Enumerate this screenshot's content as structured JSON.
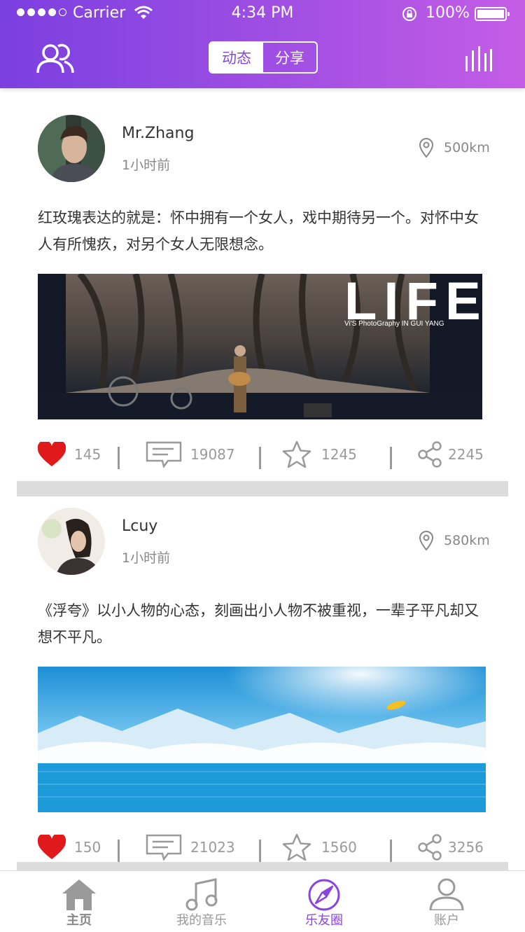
{
  "status_bar": {
    "carrier": "Carrier",
    "time": "4:34 PM",
    "battery": "100%"
  },
  "header": {
    "tabs": [
      {
        "label": "动态",
        "active": true
      },
      {
        "label": "分享",
        "active": false
      }
    ]
  },
  "colors": {
    "accent": "#8a44df",
    "heart": "#e01a1a",
    "gradient_start": "#7b3fe0",
    "gradient_end": "#c45de6"
  },
  "posts": [
    {
      "username": "Mr.Zhang",
      "time": "1小时前",
      "distance": "500km",
      "text": "红玫瑰表达的就是：怀中拥有一个女人，戏中期待另一个。对怀中女人有所愧疚，对另个女人无限想念。",
      "image": {
        "title": "LIFE",
        "subtitle": "Vi'S PhotoGraphy IN GUI YANG"
      },
      "likes": "145",
      "comments": "19087",
      "favorites": "1245",
      "shares": "2245"
    },
    {
      "username": "Lcuy",
      "time": "1小时前",
      "distance": "580km",
      "text": "《浮夸》以小人物的心态，刻画出小人物不被重视，一辈子平凡却又想不平凡。",
      "likes": "150",
      "comments": "21023",
      "favorites": "1560",
      "shares": "3256"
    }
  ],
  "tabbar": [
    {
      "label": "主页",
      "icon": "home-icon"
    },
    {
      "label": "我的音乐",
      "icon": "music-note-icon"
    },
    {
      "label": "乐友圈",
      "icon": "compass-icon",
      "active": true
    },
    {
      "label": "账户",
      "icon": "user-icon"
    }
  ]
}
